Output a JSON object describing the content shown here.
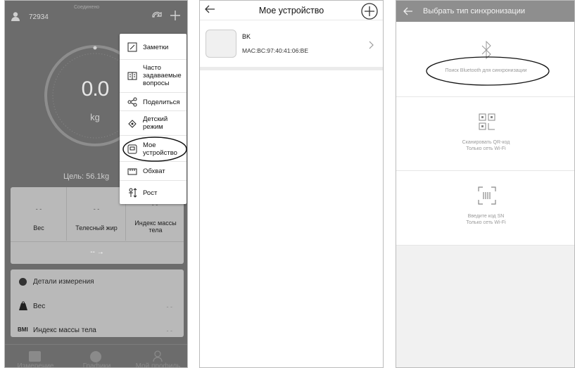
{
  "screen1": {
    "user_id": "72934",
    "status": "Соединено",
    "weight_value": "0.0",
    "weight_unit": "kg",
    "goal": "Цель: 56.1kg",
    "metrics": [
      {
        "value": "- -",
        "label": "Вес"
      },
      {
        "value": "- -",
        "label": "Телесный жир"
      },
      {
        "value": "- -",
        "label": "Индекс массы тела"
      }
    ],
    "compare": "-- →",
    "details_title": "Детали измерения",
    "details_rows": [
      {
        "icon": "weight-icon",
        "label": "Вес",
        "value": "- -"
      },
      {
        "icon": "bmi-icon",
        "prefix": "BMI",
        "label": "Индекс массы тела",
        "value": "- -"
      }
    ],
    "menu_items": [
      {
        "icon": "notes-icon",
        "label": "Заметки"
      },
      {
        "icon": "faq-icon",
        "label": "Часто задаваемые вопросы"
      },
      {
        "icon": "share-icon",
        "label": "Поделиться"
      },
      {
        "icon": "child-mode-icon",
        "label": "Детский режим"
      },
      {
        "icon": "device-icon",
        "label": "Мое устройство"
      },
      {
        "icon": "tape-measure-icon",
        "label": "Обхват"
      },
      {
        "icon": "height-icon",
        "label": "Рост"
      }
    ],
    "tabs": [
      {
        "icon": "scale-tab-icon",
        "label": "Измерение"
      },
      {
        "icon": "charts-tab-icon",
        "label": "Графики"
      },
      {
        "icon": "profile-tab-icon",
        "label": "Мой профиль"
      }
    ]
  },
  "screen2": {
    "title": "Мое устройство",
    "device": {
      "name": "BK",
      "mac": "MAC:BC:97:40:41:06:BE"
    }
  },
  "screen3": {
    "title": "Выбрать тип синхронизации",
    "options": [
      {
        "icon": "bluetooth-icon",
        "lines": [
          "Поиск Bluetooth для синхронизации"
        ]
      },
      {
        "icon": "qr-code-icon",
        "lines": [
          "Сканировать QR-код",
          "Только сеть Wi-Fi"
        ]
      },
      {
        "icon": "barcode-icon",
        "lines": [
          "Введите код SN",
          "Только сеть Wi-Fi"
        ]
      }
    ]
  },
  "colors": {
    "overlay": "#6c6c6c",
    "card": "#b9b9b9",
    "header3": "#8e8e8e",
    "annotation": "#111111"
  }
}
